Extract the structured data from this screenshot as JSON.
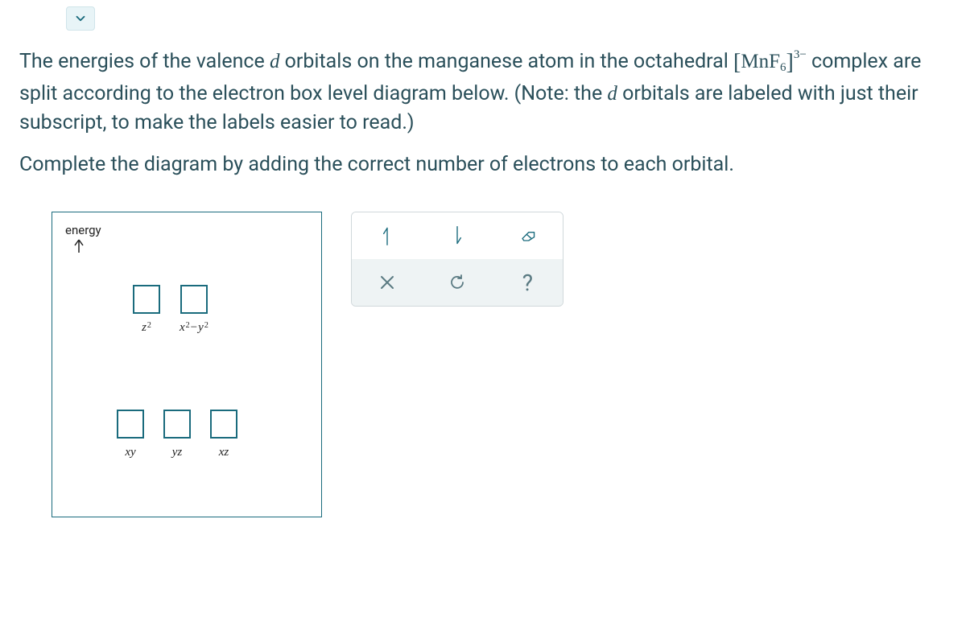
{
  "question": {
    "p1_pre": "The energies of the valence ",
    "p1_d": "d",
    "p1_mid": " orbitals on the manganese atom in the octahedral ",
    "formula_element": "MnF",
    "formula_sub": "6",
    "formula_sup": "3−",
    "p1_post": " complex are split according to the electron box level diagram below. (Note: the ",
    "p1_d2": "d",
    "p1_end": " orbitals are labeled with just their subscript, to make the labels easier to read.)",
    "p2": "Complete the diagram by adding the correct number of electrons to each orbital."
  },
  "diagram": {
    "energy_label": "energy",
    "eg_orbitals": [
      {
        "name": "z2",
        "base": "z",
        "sup": "2"
      },
      {
        "name": "x2-y2",
        "base": "x",
        "sup": "2",
        "minus": "−",
        "base2": "y",
        "sup2": "2"
      }
    ],
    "t2g_orbitals": [
      {
        "name": "xy",
        "label": "xy"
      },
      {
        "name": "yz",
        "label": "yz"
      },
      {
        "name": "xz",
        "label": "xz"
      }
    ]
  },
  "tools": {
    "spin_up": "↿",
    "spin_down": "⇂",
    "clear": "×",
    "reset": "↺",
    "help": "?"
  },
  "colors": {
    "accent": "#1a6b7d",
    "text": "#2a4f5a"
  }
}
